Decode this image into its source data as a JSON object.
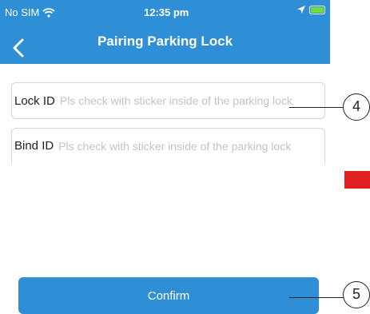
{
  "status_bar": {
    "carrier": "No SIM",
    "time": "12:35 pm",
    "icons": [
      "wifi-icon",
      "location-arrow-icon",
      "battery-charging-icon"
    ]
  },
  "header": {
    "title": "Pairing Parking Lock",
    "back_icon": "chevron-left-icon"
  },
  "form": {
    "lock_id": {
      "label": "Lock ID",
      "placeholder": "Pls check with sticker inside of the parking lock",
      "value": ""
    },
    "bind_id": {
      "label": "Bind ID",
      "placeholder": "Pls check with sticker inside of the parking lock",
      "value": ""
    }
  },
  "confirm_label": "Confirm",
  "callouts": [
    "4",
    "5"
  ],
  "colors": {
    "header_bg": "#2f8fd6",
    "button_bg": "#2f8fd6",
    "red_marker": "#e02020"
  }
}
